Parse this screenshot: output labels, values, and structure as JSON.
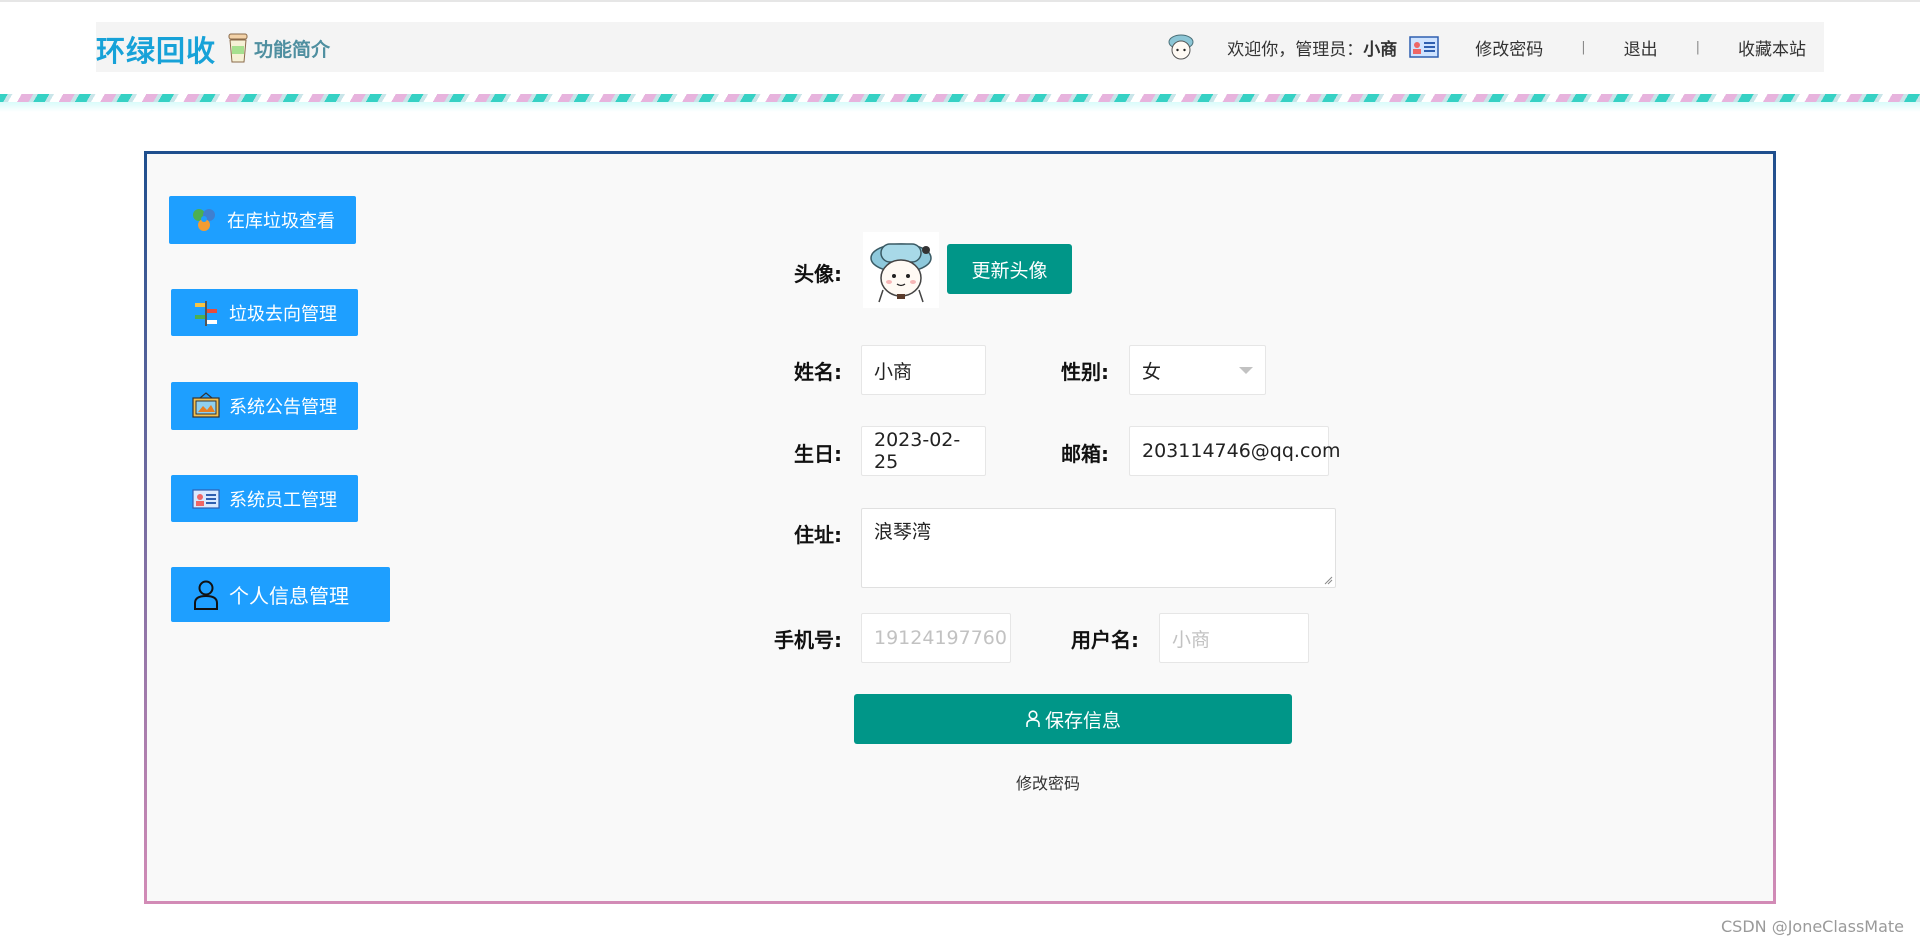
{
  "header": {
    "brand": "环绿回收",
    "intro_label": "功能简介",
    "welcome_prefix": "欢迎你，管理员：",
    "username": "小商",
    "change_password": "修改密码",
    "separator": "|",
    "logout": "退出",
    "bookmark": "收藏本站"
  },
  "sidebar": {
    "items": [
      {
        "label": "在库垃圾查看",
        "icon": "recycle-icon"
      },
      {
        "label": "垃圾去向管理",
        "icon": "signpost-icon"
      },
      {
        "label": "系统公告管理",
        "icon": "notice-board-icon"
      },
      {
        "label": "系统员工管理",
        "icon": "id-card-icon"
      },
      {
        "label": "个人信息管理",
        "icon": "user-icon"
      }
    ]
  },
  "form": {
    "avatar_label": "头像:",
    "update_avatar": "更新头像",
    "name_label": "姓名:",
    "name_value": "小商",
    "gender_label": "性别:",
    "gender_value": "女",
    "birthday_label": "生日:",
    "birthday_value": "2023-02-25",
    "email_label": "邮箱:",
    "email_value": "203114746@qq.com",
    "address_label": "住址:",
    "address_value": "浪琴湾",
    "phone_label": "手机号:",
    "phone_placeholder": "19124197760",
    "username_label": "用户名:",
    "username_placeholder": "小商",
    "save_button": "保存信息",
    "change_password_link": "修改密码"
  },
  "watermark": "CSDN @JoneClassMate",
  "colors": {
    "brand": "#17a2d8",
    "menu_blue": "#1e9fff",
    "teal": "#009688",
    "panel_border_top": "#1f4f8e",
    "panel_border_bottom": "#d28bb6"
  }
}
